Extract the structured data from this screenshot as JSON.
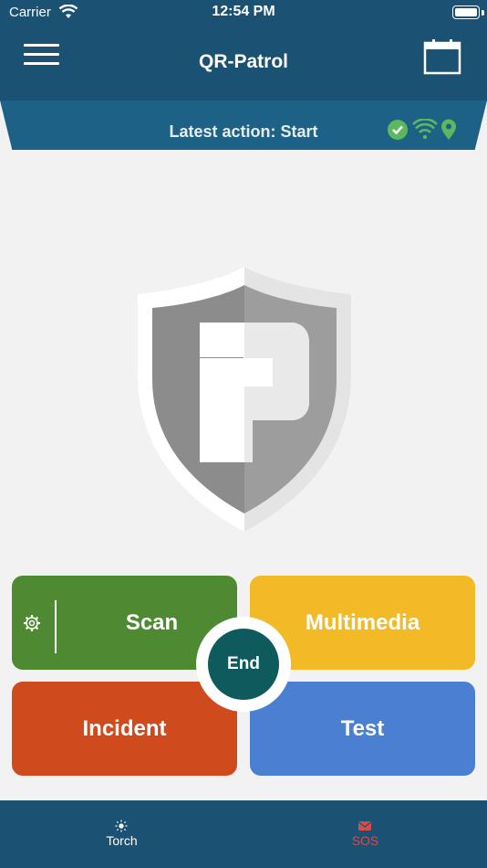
{
  "status_bar": {
    "carrier": "Carrier",
    "time": "12:54 PM",
    "battery_level": 1.0
  },
  "header": {
    "title": "QR-Patrol",
    "menu_icon": "hamburger-menu-icon",
    "calendar_icon": "calendar-icon"
  },
  "banner": {
    "text": "Latest action: Start",
    "status_icons": [
      "check-circle-icon",
      "wifi-icon",
      "location-pin-icon"
    ],
    "status_color": "#5cb85c"
  },
  "actions": {
    "scan_label": "Scan",
    "multimedia_label": "Multimedia",
    "incident_label": "Incident",
    "test_label": "Test",
    "end_label": "End"
  },
  "tabbar": {
    "torch_label": "Torch",
    "sos_label": "SOS",
    "torch_icon": "sun-icon",
    "sos_icon": "envelope-icon"
  },
  "colors": {
    "header_bg": "#1b5273",
    "banner_bg": "#1d6286",
    "scan": "#4d8a32",
    "multimedia": "#f2ba26",
    "incident": "#cf4b1e",
    "test": "#4a7fd1",
    "end": "#0f5a5d",
    "sos": "#d94b4b"
  }
}
